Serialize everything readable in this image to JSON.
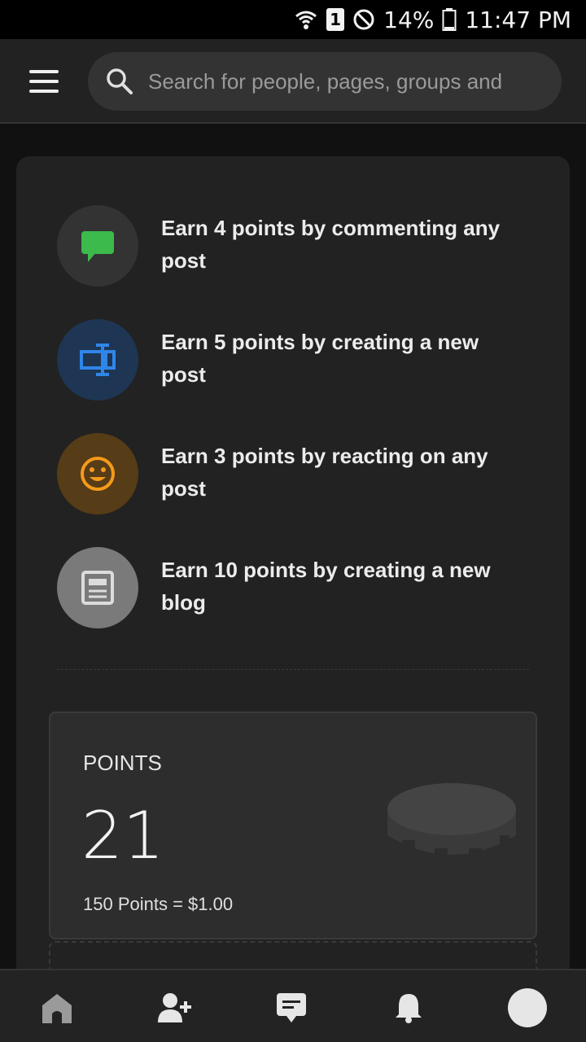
{
  "status_bar": {
    "battery": "14%",
    "time": "11:47 PM",
    "sim_slot": "1"
  },
  "search": {
    "placeholder": "Search for people, pages, groups and"
  },
  "earn_items": [
    {
      "text": "Earn 4 points by commenting any post",
      "icon": "comment-icon",
      "color": "#3cba4c",
      "bg": "#333333"
    },
    {
      "text": "Earn 5 points by creating a new post",
      "icon": "create-post-icon",
      "color": "#2f86e8",
      "bg": "#1e3553"
    },
    {
      "text": "Earn 3 points by reacting on any post",
      "icon": "smiley-icon",
      "color": "#f59a1b",
      "bg": "#563c17"
    },
    {
      "text": "Earn 10 points by creating a new blog",
      "icon": "blog-icon",
      "color": "#d9d9d9",
      "bg": "#7a7a7a"
    }
  ],
  "points": {
    "label": "POINTS",
    "value": "21",
    "rate": "150 Points = $1.00"
  },
  "nav": {
    "items": [
      "home-icon",
      "add-friend-icon",
      "messages-icon",
      "notifications-icon",
      "avatar"
    ]
  }
}
